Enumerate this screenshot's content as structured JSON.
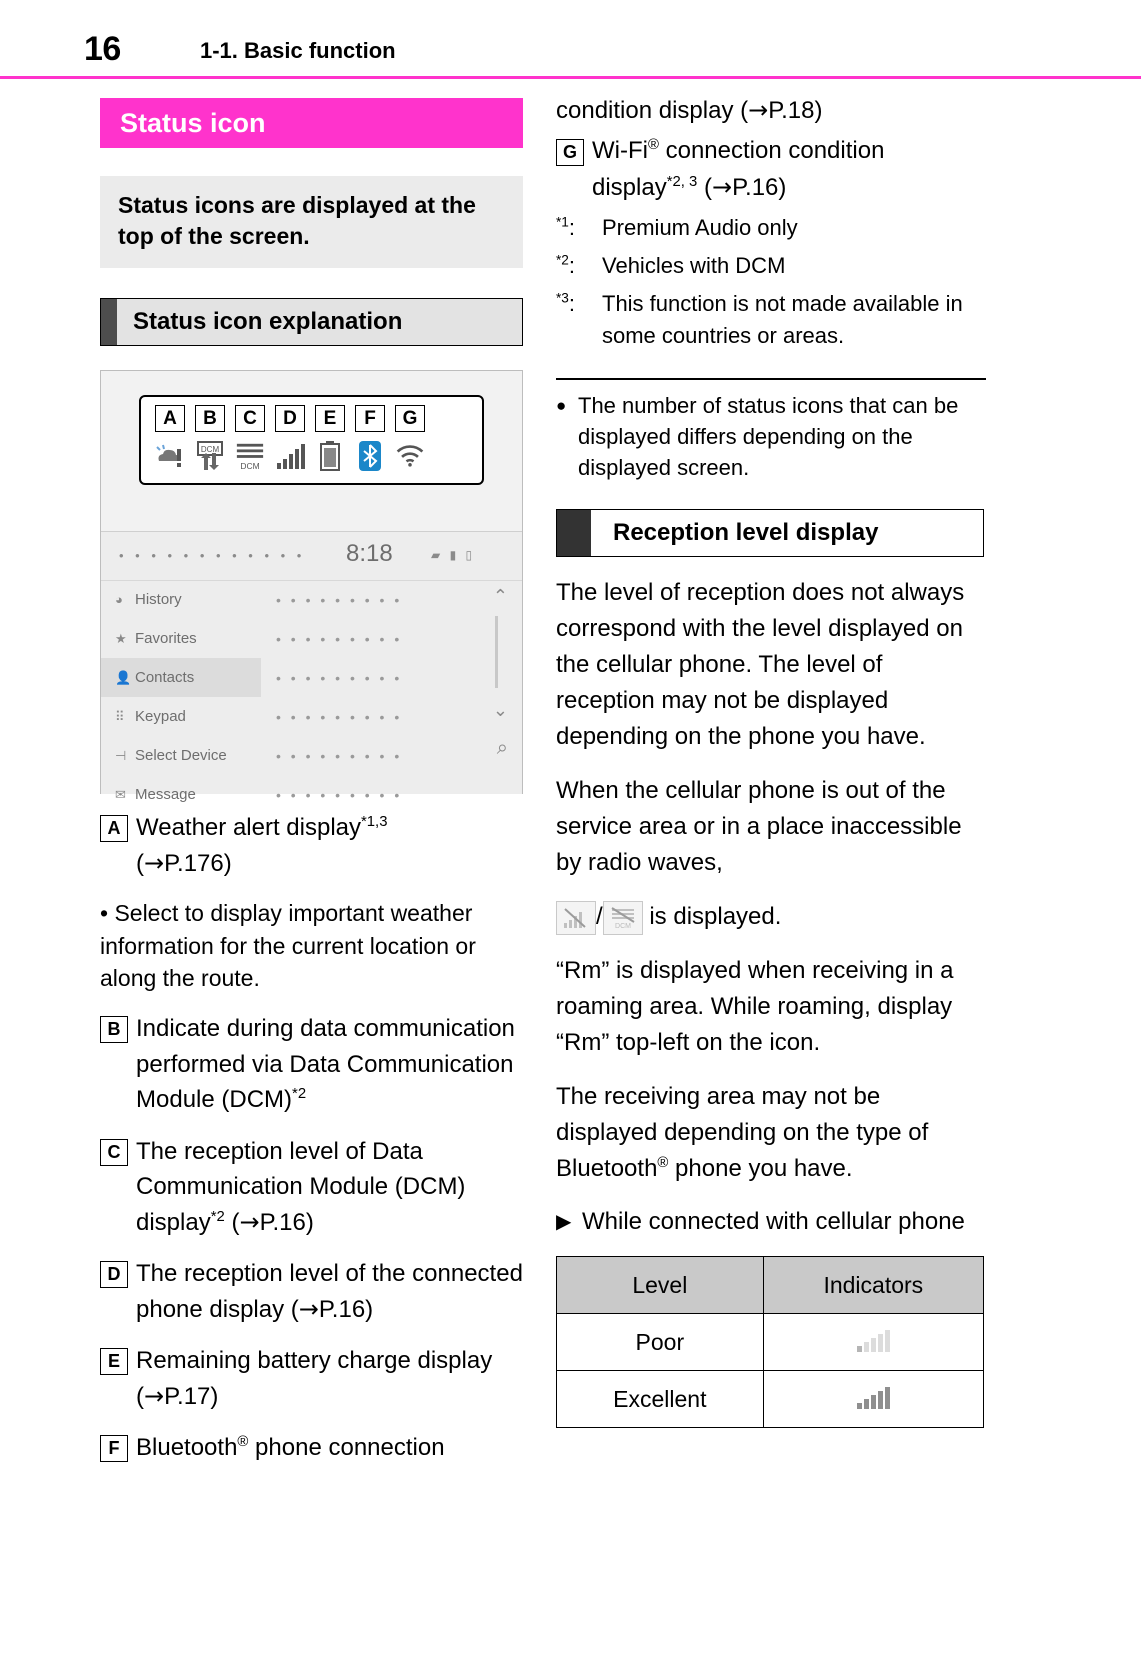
{
  "header": {
    "page_number": "16",
    "title": "1-1. Basic function",
    "rule_color": "#ff33cc"
  },
  "left": {
    "magenta_heading": "Status icon",
    "intro_box": "Status icons are displayed at the top of the screen.",
    "section_heading": "Status icon explanation",
    "illustration": {
      "letters": [
        "A",
        "B",
        "C",
        "D",
        "E",
        "F",
        "G"
      ],
      "icons": [
        "weather-alert-icon",
        "dcm-data-communication-icon",
        "dcm-reception-level-icon",
        "phone-reception-level-icon",
        "battery-icon",
        "bluetooth-icon",
        "wifi-icon"
      ],
      "screen": {
        "clock": "8:18",
        "dots": "• • • • • • • • • • • •",
        "status_mini": "▰ ▮ ▯",
        "menu": [
          {
            "icon": "history-icon",
            "label": "History",
            "selected": false
          },
          {
            "icon": "star-icon",
            "label": "Favorites",
            "selected": false
          },
          {
            "icon": "contacts-icon",
            "label": "Contacts",
            "selected": true
          },
          {
            "icon": "keypad-icon",
            "label": "Keypad",
            "selected": false
          },
          {
            "icon": "select-device-icon",
            "label": "Select Device",
            "selected": false
          },
          {
            "icon": "message-icon",
            "label": "Message",
            "selected": false
          }
        ],
        "row_placeholder": "• • • • • • • • •",
        "rows_count": 6,
        "arrow_up": "⌃",
        "arrow_down": "⌄",
        "search_icon": "search-icon"
      }
    },
    "items": [
      {
        "tag": "A",
        "text_parts": [
          {
            "t": "Weather alert display"
          },
          {
            "sup": "*1,3"
          },
          {
            "t": " ("
          },
          {
            "arrow": "→"
          },
          {
            "t": "P.176)"
          }
        ]
      }
    ],
    "bullet": "• Select to display important weather information for the current location or along the route.",
    "items2": [
      {
        "tag": "B",
        "text_parts": [
          {
            "t": "Indicate during data communication performed via Data Communication Module (DCM)"
          },
          {
            "sup": "*2"
          }
        ]
      },
      {
        "tag": "C",
        "text_parts": [
          {
            "t": "The reception level of Data Communication Module (DCM) display"
          },
          {
            "sup": "*2"
          },
          {
            "t": " ("
          },
          {
            "arrow": "→"
          },
          {
            "t": "P.16)"
          }
        ]
      },
      {
        "tag": "D",
        "text_parts": [
          {
            "t": "The reception level of the connected phone display ("
          },
          {
            "arrow": "→"
          },
          {
            "t": "P.16)"
          }
        ]
      },
      {
        "tag": "E",
        "text_parts": [
          {
            "t": "Remaining battery charge display ("
          },
          {
            "arrow": "→"
          },
          {
            "t": "P.17)"
          }
        ]
      },
      {
        "tag": "F",
        "text_parts": [
          {
            "t": "Bluetooth"
          },
          {
            "sup": "®"
          },
          {
            "t": " phone connection"
          }
        ]
      }
    ]
  },
  "right": {
    "continued_line": "condition display (→P.18)",
    "item_g": {
      "tag": "G",
      "line1_pre": "Wi-Fi",
      "line1_sup": "®",
      "line1_post": " connection condition",
      "line2_pre": "display",
      "line2_sup": "*2, 3",
      "line2_post": " (→P.16)"
    },
    "footnotes": [
      {
        "mark": "*1:",
        "text": "Premium Audio only"
      },
      {
        "mark": "*2:",
        "text": "Vehicles with DCM"
      },
      {
        "mark": "*3:",
        "text": "This function is not made available in some countries or areas."
      }
    ],
    "note_bullet": {
      "marker": "●",
      "text": "The number of status icons that can be displayed differs depending on the displayed screen."
    },
    "section_heading": "Reception level display",
    "paragraphs": [
      "The level of reception does not always correspond with the level displayed on the cellular phone. The level of reception may not be displayed depending on the phone you have.",
      "When the cellular phone is out of the service area or in a place inaccessible by radio waves,",
      "“Rm” is displayed when receiving in a roaming area. While roaming, display “Rm” top-left on the icon.",
      "The receiving area may not be displayed depending on the type of Bluetooth® phone you have."
    ],
    "displayed_line": {
      "icon1": "no-signal-bars-icon",
      "sep": "/",
      "icon2": "no-signal-dcm-icon",
      "text": " is displayed."
    },
    "subheading": {
      "marker": "▶",
      "text": "While connected with cellular phone"
    },
    "table": {
      "headers": [
        "Level",
        "Indicators"
      ],
      "rows": [
        {
          "level": "Poor",
          "indicator": "signal-bars-poor-icon",
          "bars_filled": 1,
          "bars_total": 5
        },
        {
          "level": "Excellent",
          "indicator": "signal-bars-excellent-icon",
          "bars_filled": 5,
          "bars_total": 5
        }
      ]
    }
  }
}
